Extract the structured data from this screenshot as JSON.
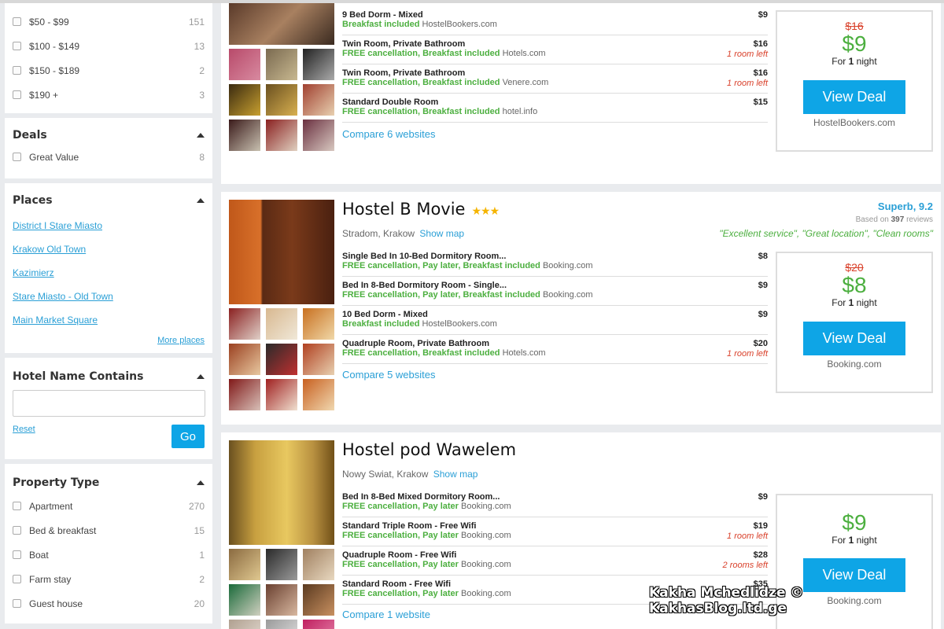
{
  "filters": {
    "price": [
      {
        "label": "$50 - $99",
        "count": "151"
      },
      {
        "label": "$100 - $149",
        "count": "13"
      },
      {
        "label": "$150 - $189",
        "count": "2"
      },
      {
        "label": "$190 +",
        "count": "3"
      }
    ],
    "deals_title": "Deals",
    "deals": [
      {
        "label": "Great Value",
        "count": "8"
      }
    ],
    "places_title": "Places",
    "places": [
      "District I Stare Miasto",
      "Krakow Old Town",
      "Kazimierz",
      "Stare Miasto - Old Town",
      "Main Market Square"
    ],
    "more_places": "More places",
    "hotel_name_title": "Hotel Name Contains",
    "hotel_name_value": "",
    "reset": "Reset",
    "go": "Go",
    "property_title": "Property Type",
    "property": [
      {
        "label": "Apartment",
        "count": "270"
      },
      {
        "label": "Bed & breakfast",
        "count": "15"
      },
      {
        "label": "Boat",
        "count": "1"
      },
      {
        "label": "Farm stay",
        "count": "2"
      },
      {
        "label": "Guest house",
        "count": "20"
      }
    ]
  },
  "hotels": [
    {
      "rooms": [
        {
          "name": "9 Bed Dorm - Mixed",
          "price": "$9",
          "green": "Breakfast included",
          "src": "HostelBookers.com",
          "left": ""
        },
        {
          "name": "Twin Room, Private Bathroom",
          "price": "$16",
          "green": "FREE cancellation, Breakfast included",
          "src": "Hotels.com",
          "left": "1 room left"
        },
        {
          "name": "Twin Room, Private Bathroom",
          "price": "$16",
          "green": "FREE cancellation, Breakfast included",
          "src": "Venere.com",
          "left": "1 room left"
        },
        {
          "name": "Standard Double Room",
          "price": "$15",
          "green": "FREE cancellation, Breakfast included",
          "src": "hotel.info",
          "left": ""
        }
      ],
      "compare": "Compare 6 websites",
      "deal": {
        "old": "$16",
        "price": "$9",
        "night_pre": "For ",
        "night_num": "1",
        "night_post": " night",
        "button": "View Deal",
        "source": "HostelBookers.com"
      }
    },
    {
      "name": "Hostel B Movie",
      "stars": "★★★",
      "location": "Stradom, Krakow",
      "show_map": "Show map",
      "rating_label": "Superb, 9.2",
      "reviews_pre": "Based on ",
      "reviews_num": "397",
      "reviews_post": " reviews",
      "quotes": "\"Excellent service\", \"Great location\", \"Clean rooms\"",
      "rooms": [
        {
          "name": "Single Bed In 10-Bed Dormitory Room...",
          "price": "$8",
          "green": "FREE cancellation, Pay later, Breakfast included",
          "src": "Booking.com",
          "left": ""
        },
        {
          "name": "Bed In 8-Bed Dormitory Room - Single...",
          "price": "$9",
          "green": "FREE cancellation, Pay later, Breakfast included",
          "src": "Booking.com",
          "left": ""
        },
        {
          "name": "10 Bed Dorm - Mixed",
          "price": "$9",
          "green": "Breakfast included",
          "src": "HostelBookers.com",
          "left": ""
        },
        {
          "name": "Quadruple Room, Private Bathroom",
          "price": "$20",
          "green": "FREE cancellation, Breakfast included",
          "src": "Hotels.com",
          "left": "1 room left"
        }
      ],
      "compare": "Compare 5 websites",
      "deal": {
        "old": "$20",
        "price": "$8",
        "night_pre": "For ",
        "night_num": "1",
        "night_post": " night",
        "button": "View Deal",
        "source": "Booking.com"
      }
    },
    {
      "name": "Hostel pod Wawelem",
      "location": "Nowy Swiat, Krakow",
      "show_map": "Show map",
      "rooms": [
        {
          "name": "Bed In 8-Bed Mixed Dormitory Room...",
          "price": "$9",
          "green": "FREE cancellation, Pay later",
          "src": "Booking.com",
          "left": ""
        },
        {
          "name": "Standard Triple Room - Free Wifi",
          "price": "$19",
          "green": "FREE cancellation, Pay later",
          "src": "Booking.com",
          "left": "1 room left"
        },
        {
          "name": "Quadruple Room - Free Wifi",
          "price": "$28",
          "green": "FREE cancellation, Pay later",
          "src": "Booking.com",
          "left": "2 rooms left"
        },
        {
          "name": "Standard Room - Free Wifi",
          "price": "$35",
          "green": "FREE cancellation, Pay later",
          "src": "Booking.com",
          "left": ""
        }
      ],
      "compare": "Compare 1 website",
      "deal": {
        "price": "$9",
        "night_pre": "For ",
        "night_num": "1",
        "night_post": " night",
        "button": "View Deal",
        "source": "Booking.com"
      }
    }
  ],
  "watermark": "Kakha Mchedlidze © KakhasBlog.ltd.ge",
  "colors": {
    "accent": "#0ea5e6",
    "green": "#4caf3f",
    "red": "#d9412b",
    "star": "#f5b400"
  }
}
